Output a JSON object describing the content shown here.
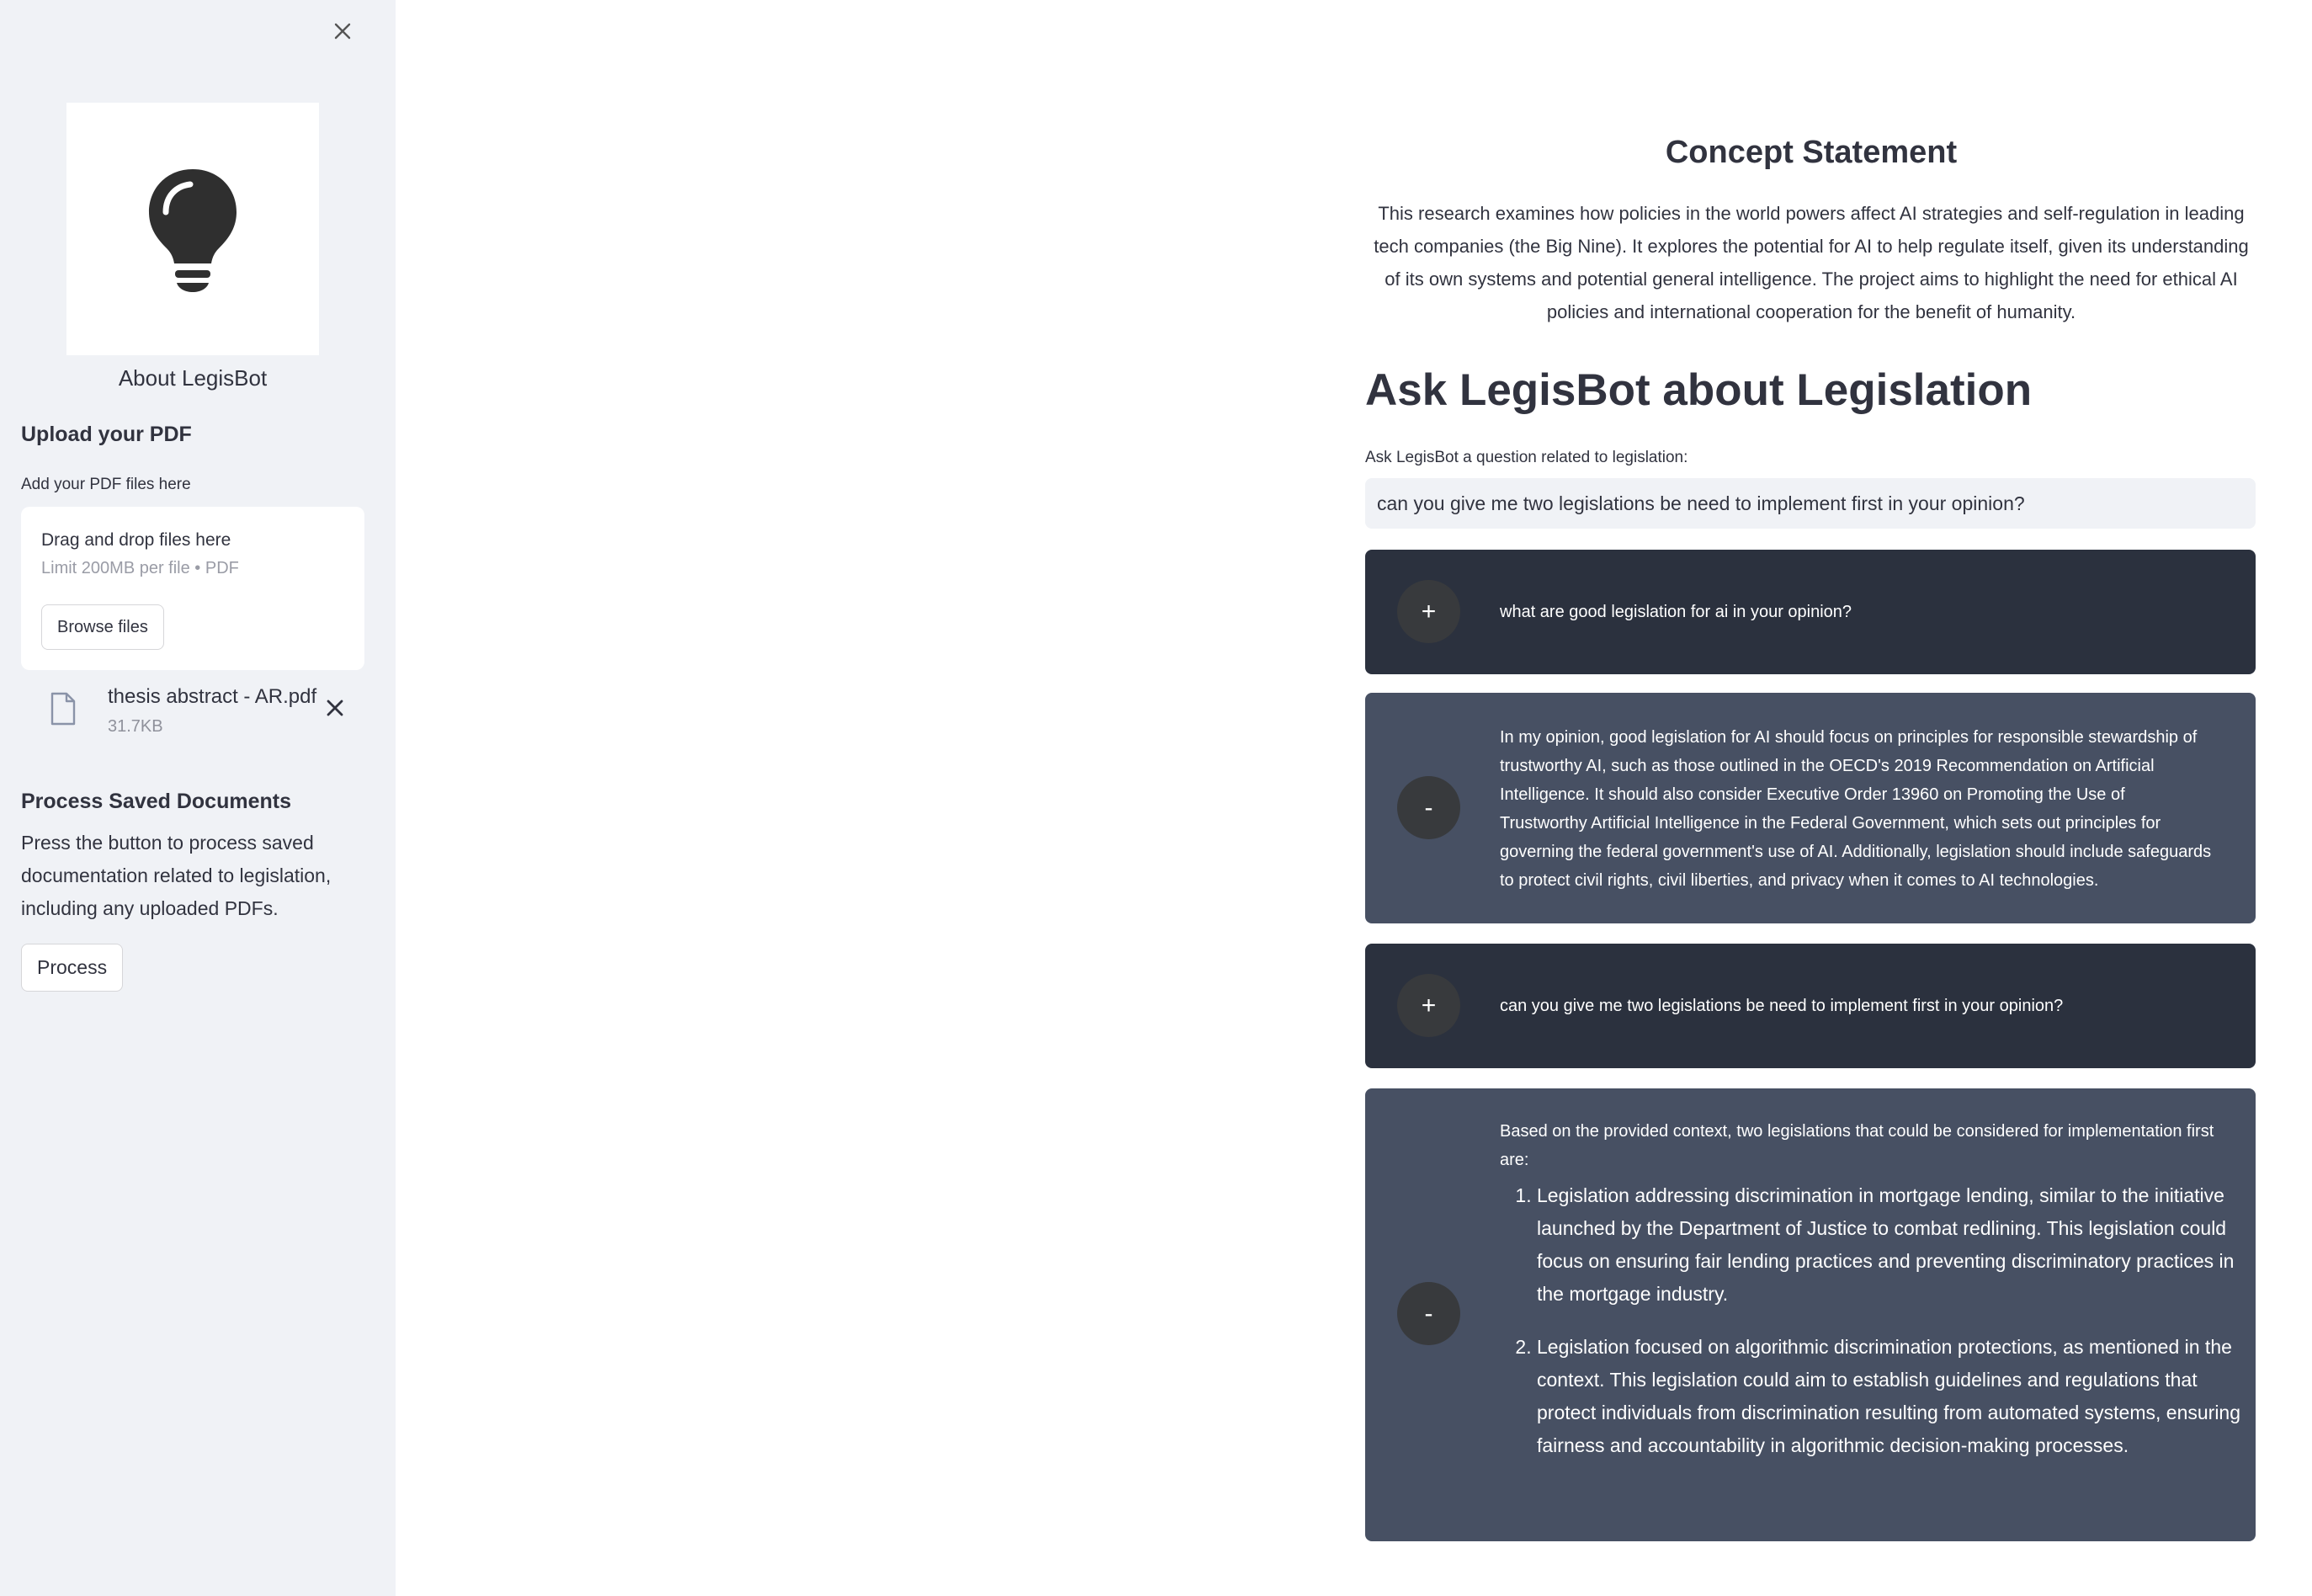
{
  "sidebar": {
    "about_label": "About LegisBot",
    "upload_title": "Upload your PDF",
    "upload_label": "Add your PDF files here",
    "dropzone_title": "Drag and drop files here",
    "dropzone_limit": "Limit 200MB per file • PDF",
    "browse_label": "Browse files",
    "file": {
      "name": "thesis abstract - AR.pdf",
      "size": "31.7KB"
    },
    "process_title": "Process Saved Documents",
    "process_desc": "Press the button to process saved documentation related to legislation, including any uploaded PDFs.",
    "process_label": "Process"
  },
  "main": {
    "concept_title": "Concept Statement",
    "concept_text": "This research examines how policies in the world powers affect AI strategies and self-regulation in leading tech companies (the Big Nine). It explores the potential for AI to help regulate itself, given its understanding of its own systems and potential general intelligence. The project aims to highlight the need for ethical AI policies and international cooperation for the benefit of humanity.",
    "ask_title": "Ask LegisBot about Legislation",
    "ask_label": "Ask LegisBot a question related to legislation:",
    "ask_value": "can you give me two legislations be need to implement first in your opinion?"
  },
  "chat": {
    "user_avatar": "+",
    "bot_avatar": "-",
    "m1": "what are good legislation for ai in your opinion?",
    "m2": "In my opinion, good legislation for AI should focus on principles for responsible stewardship of trustworthy AI, such as those outlined in the OECD's 2019 Recommendation on Artificial Intelligence. It should also consider Executive Order 13960 on Promoting the Use of Trustworthy Artificial Intelligence in the Federal Government, which sets out principles for governing the federal government's use of AI. Additionally, legislation should include safeguards to protect civil rights, civil liberties, and privacy when it comes to AI technologies.",
    "m3": "can you give me two legislations be need to implement first in your opinion?",
    "m4_intro": "Based on the provided context, two legislations that could be considered for implementation first are:",
    "m4_items": [
      "Legislation addressing discrimination in mortgage lending, similar to the initiative launched by the Department of Justice to combat redlining. This legislation could focus on ensuring fair lending practices and preventing discriminatory practices in the mortgage industry.",
      "Legislation focused on algorithmic discrimination protections, as mentioned in the context. This legislation could aim to establish guidelines and regulations that protect individuals from discrimination resulting from automated systems, ensuring fairness and accountability in algorithmic decision-making processes."
    ]
  },
  "colors": {
    "sidebar_bg": "#f0f2f6",
    "user_msg_bg": "#2b313e",
    "bot_msg_bg": "#475063",
    "avatar_bg": "#383a3d"
  },
  "icons": {
    "close": "close-icon",
    "logo": "lightbulb-icon",
    "file": "file-icon",
    "remove": "remove-file-icon"
  }
}
